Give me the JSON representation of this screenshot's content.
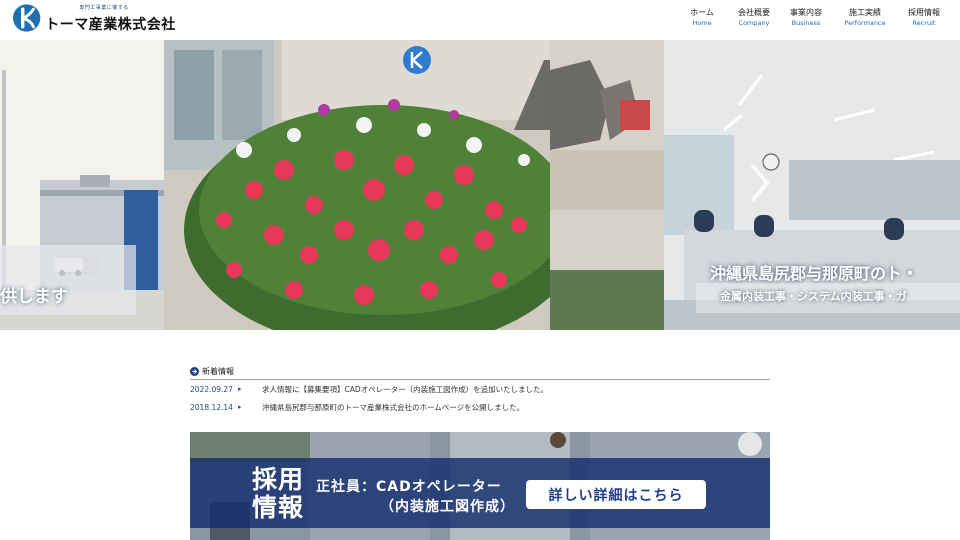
{
  "brand": {
    "tagline": "専門工事業に徹する",
    "name": "トーマ産業株式会社",
    "logo_icon": "company-logo-icon",
    "color": "#1f6fb2"
  },
  "nav": {
    "items": [
      {
        "jp": "ホーム",
        "en": "Home"
      },
      {
        "jp": "会社概要",
        "en": "Company"
      },
      {
        "jp": "事業内容",
        "en": "Business"
      },
      {
        "jp": "施工実績",
        "en": "Performance"
      },
      {
        "jp": "採用情報",
        "en": "Recruit"
      }
    ]
  },
  "hero": {
    "left_text": "供します",
    "right_title": "沖縄県島尻郡与那原町のト・",
    "right_sub": "金属内装工事・システム内装工事・ガ",
    "arrow_icon": "chevron-right-icon"
  },
  "news": {
    "title": "新着情報",
    "icon": "arrow-circle-right-icon",
    "items": [
      {
        "date": "2022.09.27",
        "text": "求人情報に【募集要項】CADオペレーター（内装施工図作成）を追加いたしました。"
      },
      {
        "date": "2018.12.14",
        "text": "沖縄県島尻郡与那原町のトーマ産業株式会社のホームページを公開しました。"
      }
    ]
  },
  "recruit": {
    "big_label": "採用情報",
    "role": "正社員：CADオペレーター",
    "detail": "（内装施工図作成）",
    "button": "詳しい詳細はこちら"
  }
}
